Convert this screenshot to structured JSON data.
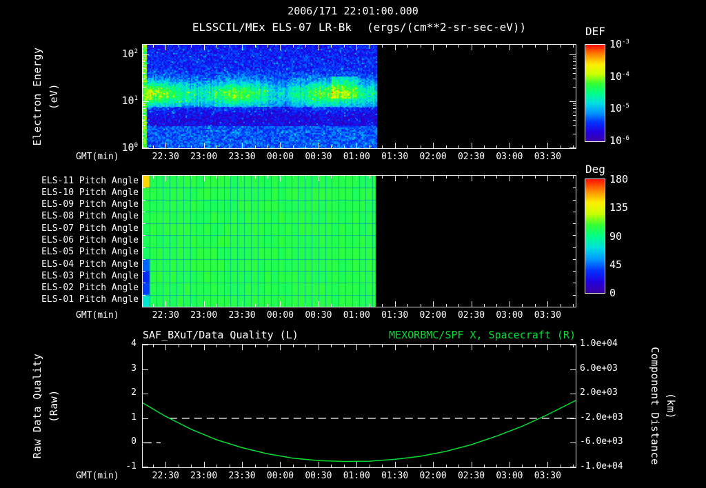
{
  "title": "2006/171 22:01:00.000",
  "colors": {
    "background": "#000000",
    "foreground": "#ffffff",
    "accent_green": "#00dd33",
    "colormap": [
      "#3c00a0",
      "#2200e0",
      "#0033ff",
      "#0099ff",
      "#00e0e0",
      "#00ff88",
      "#33ff33",
      "#ccff00",
      "#ffee00",
      "#ff8800",
      "#ff1100"
    ]
  },
  "time_axis": {
    "label": "GMT(min)",
    "start": "22:12",
    "end": "03:52",
    "ticks": [
      "22:30",
      "23:00",
      "23:30",
      "00:00",
      "00:30",
      "01:00",
      "01:30",
      "02:00",
      "02:30",
      "03:00",
      "03:30"
    ]
  },
  "chart_data": [
    {
      "id": "electron-energy-spectrogram",
      "type": "heatmap",
      "title": "ELSSCIL/MEx ELS-07 LR-Bk",
      "units": "(ergs/(cm**2-sr-sec-eV))",
      "xlabel": "GMT(min)",
      "ylabel_lines": [
        "Electron Energy",
        "(eV)"
      ],
      "yscale": "log",
      "ylim_ev": [
        1,
        158
      ],
      "y_log_max": 2.2,
      "y_ticks_exponents": [
        2,
        1,
        0
      ],
      "x_range": [
        "22:12",
        "03:52"
      ],
      "data_coverage": [
        "22:12",
        "01:15"
      ],
      "color_scale": {
        "label": "DEF",
        "scale": "log",
        "min": 1e-06,
        "max": 0.001,
        "tick_exponents": [
          -3,
          -4,
          -5,
          -6
        ]
      },
      "features": {
        "background": {
          "energy_ev": [
            1,
            158
          ],
          "level_def": 4e-06
        },
        "band": {
          "energy_ev": [
            10,
            22
          ],
          "level_def": 5e-05,
          "extent": [
            "22:12",
            "01:15"
          ]
        },
        "low_energy_gap": {
          "energy_ev": [
            3,
            8
          ],
          "level_def": 1.5e-06
        },
        "start_burst": {
          "extent": [
            "22:12",
            "22:15"
          ],
          "level_def": 8e-05
        },
        "late_enhancement": {
          "energy_ev": [
            12,
            35
          ],
          "extent": [
            "00:40",
            "01:00"
          ],
          "level_def": 0.00012
        },
        "no_data_after": "01:15"
      }
    },
    {
      "id": "pitch-angle-grid",
      "type": "heatmap",
      "rows": [
        "ELS-11 Pitch Angle",
        "ELS-10 Pitch Angle",
        "ELS-09 Pitch Angle",
        "ELS-08 Pitch Angle",
        "ELS-07 Pitch Angle",
        "ELS-06 Pitch Angle",
        "ELS-05 Pitch Angle",
        "ELS-04 Pitch Angle",
        "ELS-03 Pitch Angle",
        "ELS-02 Pitch Angle",
        "ELS-01 Pitch Angle"
      ],
      "x_range": [
        "22:12",
        "03:52"
      ],
      "data_coverage": [
        "22:12",
        "01:15"
      ],
      "color_scale": {
        "label": "Deg",
        "min": 0,
        "max": 180,
        "tick_labels": [
          "180",
          "135",
          "90",
          "45",
          "0"
        ]
      },
      "typical_value_deg": 103,
      "first_sample_deg_by_row": [
        148,
        105,
        103,
        102,
        100,
        100,
        98,
        45,
        32,
        38,
        75
      ]
    },
    {
      "id": "quality-and-distance",
      "type": "line",
      "left_axis": {
        "title": "SAF_BXuT/Data Quality (L)",
        "ylabel_lines": [
          "Raw Data Quality",
          "(Raw)"
        ],
        "ylim": [
          -1,
          4
        ],
        "tick_labels": [
          "4",
          "3",
          "2",
          "1",
          "0",
          "-1"
        ]
      },
      "right_axis": {
        "title": "MEXORBMC/SPF X, Spacecraft (R)",
        "ylabel_lines": [
          "Component Distance",
          "(km)"
        ],
        "ylim": [
          -10000,
          10000
        ],
        "tick_labels": [
          "1.0e+04",
          "6.0e+03",
          "2.0e+03",
          "-2.0e+03",
          "-6.0e+03",
          "-1.0e+04"
        ]
      },
      "series": [
        {
          "name": "Raw Data Quality",
          "axis": "left",
          "color": "#ffffff",
          "style": "dashed",
          "segments": [
            {
              "t": [
                "22:13",
                "22:26"
              ],
              "value": 0
            },
            {
              "t": [
                "22:33",
                "03:52"
              ],
              "value": 1
            }
          ]
        },
        {
          "name": "Spacecraft X Component Distance",
          "axis": "right",
          "color": "#00dd33",
          "style": "solid",
          "points": [
            [
              "22:12",
              500
            ],
            [
              "22:30",
              -1700
            ],
            [
              "22:50",
              -3800
            ],
            [
              "23:10",
              -5500
            ],
            [
              "23:30",
              -6800
            ],
            [
              "23:50",
              -7800
            ],
            [
              "00:10",
              -8500
            ],
            [
              "00:30",
              -8900
            ],
            [
              "00:50",
              -9050
            ],
            [
              "01:10",
              -9000
            ],
            [
              "01:30",
              -8700
            ],
            [
              "01:50",
              -8200
            ],
            [
              "02:10",
              -7400
            ],
            [
              "02:30",
              -6300
            ],
            [
              "02:50",
              -4900
            ],
            [
              "03:10",
              -3300
            ],
            [
              "03:30",
              -1400
            ],
            [
              "03:52",
              900
            ]
          ]
        }
      ]
    }
  ]
}
